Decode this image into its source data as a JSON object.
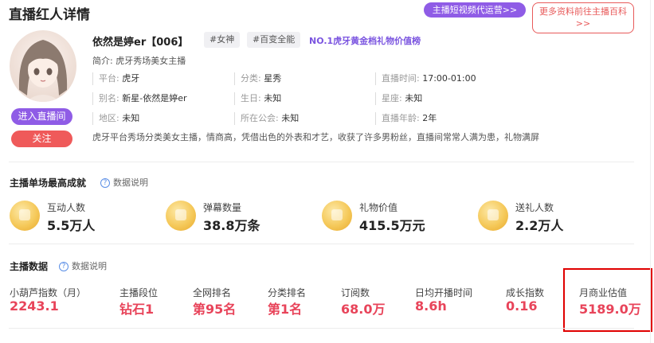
{
  "header": {
    "title": "直播红人详情",
    "video_service_btn": "主播短视频代运营>>",
    "more_info_btn": "更多资料前往主播百科>>"
  },
  "profile": {
    "enter_room_btn": "进入直播间",
    "follow_btn": "关注",
    "name": "依然是婷er【006】",
    "tags": [
      "#女神",
      "#百变全能"
    ],
    "rank_tag": "NO.1虎牙黄金档礼物价值榜",
    "intro": "简介: 虎牙秀场美女主播",
    "info": {
      "platform_label": "平台:",
      "platform": "虎牙",
      "category_label": "分类:",
      "category": "星秀",
      "time_label": "直播时间:",
      "time": "17:00-01:00",
      "alias_label": "别名:",
      "alias": "新星-依然是婷er",
      "birthday_label": "生日:",
      "birthday": "未知",
      "zodiac_label": "星座:",
      "zodiac": "未知",
      "region_label": "地区:",
      "region": "未知",
      "guild_label": "所在公会:",
      "guild": "未知",
      "years_label": "直播年龄:",
      "years": "2年"
    },
    "description": "虎牙平台秀场分类美女主播，情商高，凭借出色的外表和才艺，收获了许多男粉丝，直播间常常人满为患，礼物满屏"
  },
  "achievements": {
    "title": "主播单场最高成就",
    "help": "数据说明",
    "items": [
      {
        "label": "互动人数",
        "value": "5.5万人"
      },
      {
        "label": "弹幕数量",
        "value": "38.8万条"
      },
      {
        "label": "礼物价值",
        "value": "415.5万元"
      },
      {
        "label": "送礼人数",
        "value": "2.2万人"
      }
    ]
  },
  "stats": {
    "title": "主播数据",
    "help": "数据说明",
    "items": [
      {
        "label": "小葫芦指数（月）",
        "value": "2243.1"
      },
      {
        "label": "主播段位",
        "value": "钻石1"
      },
      {
        "label": "全网排名",
        "value": "第95名"
      },
      {
        "label": "分类排名",
        "value": "第1名"
      },
      {
        "label": "订阅数",
        "value": "68.0万"
      },
      {
        "label": "日均开播时间",
        "value": "8.6h"
      },
      {
        "label": "成长指数",
        "value": "0.16"
      },
      {
        "label": "月商业估值",
        "value": "5189.0万"
      }
    ]
  },
  "colors": {
    "accent_purple": "#8f5ce6",
    "accent_red": "#e8445a",
    "highlight_box": "#e00000"
  }
}
